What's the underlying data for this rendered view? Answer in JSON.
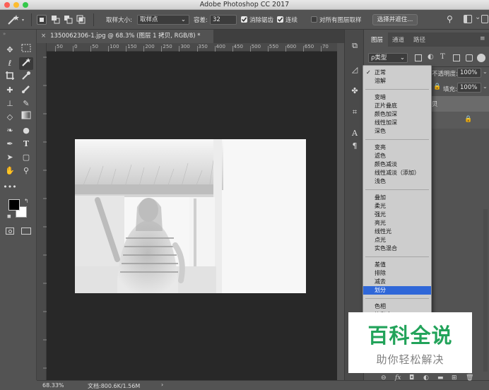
{
  "window": {
    "title": "Adobe Photoshop CC 2017",
    "traffic_colors": [
      "#fc5f57",
      "#fdbc2e",
      "#34c84a"
    ]
  },
  "options_bar": {
    "sample_size_label": "取样大小:",
    "sample_size_value": "取样点",
    "tolerance_label": "容差:",
    "tolerance_value": "32",
    "antialias_label": "消除锯齿",
    "antialias_checked": true,
    "contiguous_label": "连续",
    "contiguous_checked": true,
    "all_layers_label": "对所有图层取样",
    "all_layers_checked": false,
    "select_mask_button": "选择并遮住..."
  },
  "document": {
    "tab_title": "1350062306-1.jpg @ 68.3% (图层 1 拷贝, RGB/8) *",
    "close_glyph": "×",
    "ruler_ticks": [
      "50",
      "0",
      "50",
      "100",
      "150",
      "200",
      "250",
      "300",
      "350",
      "400",
      "450",
      "500",
      "550",
      "600",
      "650",
      "70"
    ]
  },
  "status_bar": {
    "zoom": "68.33%",
    "doc_info": "文档:800.6K/1.56M",
    "arrow": "›"
  },
  "layers_panel": {
    "tabs": [
      "图层",
      "通道",
      "路径"
    ],
    "filter_label": "ρ类型",
    "opacity_label": "不透明度:",
    "opacity_value": "100%",
    "fill_label": "填充:",
    "fill_value": "100%"
  },
  "blend_menu": {
    "groups": [
      [
        {
          "label": "正常",
          "checked": true
        },
        {
          "label": "溶解"
        }
      ],
      [
        {
          "label": "变暗"
        },
        {
          "label": "正片叠底"
        },
        {
          "label": "颜色加深"
        },
        {
          "label": "线性加深"
        },
        {
          "label": "深色"
        }
      ],
      [
        {
          "label": "变亮"
        },
        {
          "label": "滤色"
        },
        {
          "label": "颜色减淡"
        },
        {
          "label": "线性减淡（添加）"
        },
        {
          "label": "浅色"
        }
      ],
      [
        {
          "label": "叠加"
        },
        {
          "label": "柔光"
        },
        {
          "label": "强光"
        },
        {
          "label": "亮光"
        },
        {
          "label": "线性光"
        },
        {
          "label": "点光"
        },
        {
          "label": "实色混合"
        }
      ],
      [
        {
          "label": "差值"
        },
        {
          "label": "排除"
        },
        {
          "label": "减去"
        },
        {
          "label": "划分",
          "selected": true
        }
      ],
      [
        {
          "label": "色相"
        },
        {
          "label": "饱和度"
        }
      ]
    ]
  },
  "watermark": {
    "title": "百科全说",
    "subtitle": "助你轻松解决"
  }
}
